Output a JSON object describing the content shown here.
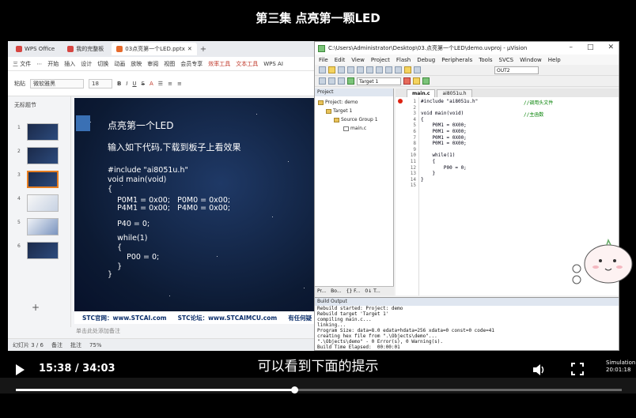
{
  "video": {
    "title": "第三集 点亮第一颗LED",
    "subtitle": "可以看到下面的提示",
    "time": "15:38 / 34:03",
    "progress_fraction": 0.459,
    "settings_line1": "Simulation",
    "settings_line2": "20:01:18"
  },
  "wps": {
    "tabs": [
      {
        "label": "WPS Office",
        "color": "#d64541"
      },
      {
        "label": "我的完整板",
        "color": "#d64541"
      },
      {
        "label": "03点亮第一个LED.pptx",
        "color": "#e66a2c"
      }
    ],
    "menu": [
      "三 文件",
      "⋯",
      "开始",
      "插入",
      "设计",
      "切换",
      "动画",
      "放映",
      "审阅",
      "视图",
      "会员专享",
      "效率工具",
      "文本工具",
      "WPS AI"
    ],
    "menu_highlight": "文本工具",
    "tools": {
      "font": "微软雅黑",
      "size": "18",
      "paste": "粘贴"
    },
    "left_panel_label": "无标题节",
    "slide_numbers": [
      "1",
      "2",
      "3",
      "4",
      "5",
      "6"
    ],
    "slide": {
      "title": "点亮第一个LED",
      "subtitle": "输入如下代码,下载到板子上看效果",
      "code": [
        "#include \"ai8051u.h\"",
        "void main(void)",
        "{",
        "    P0M1 = 0x00;   P0M0 = 0x00;",
        "    P4M1 = 0x00;   P4M0 = 0x00;",
        "    P40 = 0;",
        "    while(1)",
        "    {",
        "        P00 = 0;",
        "    }",
        "}"
      ],
      "footer": [
        "STC官网：www.STCAI.com",
        "STC论坛：www.STCAIMCU.com",
        "有任何疑"
      ]
    },
    "notes_placeholder": "单击此处添加备注",
    "status": {
      "page": "幻灯片 3 / 6",
      "zoom": "75%",
      "notes_btn": "备注",
      "comment_btn": "批注"
    }
  },
  "uvision": {
    "title": "C:\\Users\\Administrator\\Desktop\\03.点亮第一个LED\\demo.uvproj - µVision",
    "menu": [
      "File",
      "Edit",
      "View",
      "Project",
      "Flash",
      "Debug",
      "Peripherals",
      "Tools",
      "SVCS",
      "Window",
      "Help"
    ],
    "target_field": "Target 1",
    "out_field": "OUT2",
    "project_panel": "Project",
    "tree": [
      "Project: demo",
      "Target 1",
      "Source Group 1",
      "main.c"
    ],
    "project_tabs": [
      "Pr...",
      "Bo...",
      "{} F...",
      "0↓ T..."
    ],
    "editor_tabs": [
      "main.c",
      "ai8051u.h"
    ],
    "code_lines": [
      {
        "n": "1",
        "t": "#include \"ai8051u.h\"",
        "c": "//调用头文件"
      },
      {
        "n": "2",
        "t": "",
        "c": ""
      },
      {
        "n": "3",
        "t": "void main(void)",
        "c": "//主函数"
      },
      {
        "n": "4",
        "t": "{",
        "c": ""
      },
      {
        "n": "5",
        "t": "    P0M1 = 0X00;",
        "c": ""
      },
      {
        "n": "6",
        "t": "    P0M1 = 0X00;",
        "c": ""
      },
      {
        "n": "7",
        "t": "    P0M1 = 0X00;",
        "c": ""
      },
      {
        "n": "8",
        "t": "    P0M1 = 0X00;",
        "c": ""
      },
      {
        "n": "9",
        "t": "",
        "c": ""
      },
      {
        "n": "10",
        "t": "    while(1)",
        "c": ""
      },
      {
        "n": "11",
        "t": "    {",
        "c": ""
      },
      {
        "n": "12",
        "t": "        P00 = 0;",
        "c": ""
      },
      {
        "n": "13",
        "t": "    }",
        "c": ""
      },
      {
        "n": "14",
        "t": "}",
        "c": ""
      },
      {
        "n": "15",
        "t": "",
        "c": ""
      }
    ],
    "build_title": "Build Output",
    "build_lines": [
      "Rebuild started: Project: demo",
      "Rebuild target 'Target 1'",
      "compiling main.c...",
      "linking...",
      "Program Size: data=8.0 edata+hdata=256 xdata=0 const=0 code=41",
      "creating hex file from \".\\Objects\\demo\"...",
      "\".\\Objects\\demo\" - 0 Error(s), 0 Warning(s).",
      "Build Time Elapsed:  00:00:01"
    ]
  }
}
